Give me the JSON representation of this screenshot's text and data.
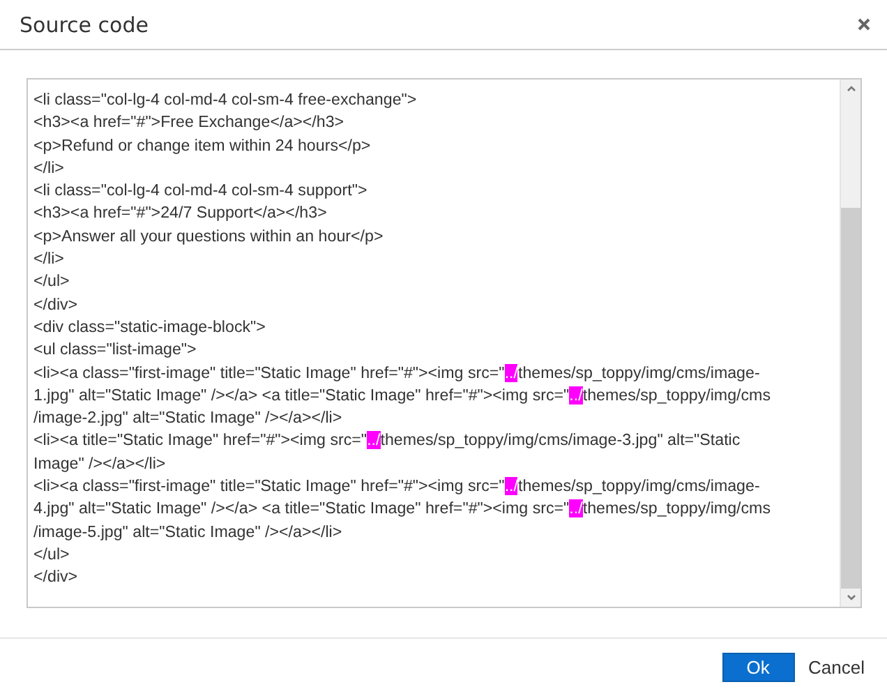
{
  "dialog": {
    "title": "Source code"
  },
  "code_lines": [
    [
      {
        "text": "<li class=\"col-lg-4 col-md-4 col-sm-4 free-exchange\">",
        "highlighted": false
      }
    ],
    [
      {
        "text": "<h3><a href=\"#\">Free Exchange</a></h3>",
        "highlighted": false
      }
    ],
    [
      {
        "text": "<p>Refund or change item within 24 hours</p>",
        "highlighted": false
      }
    ],
    [
      {
        "text": "</li>",
        "highlighted": false
      }
    ],
    [
      {
        "text": "<li class=\"col-lg-4 col-md-4 col-sm-4 support\">",
        "highlighted": false
      }
    ],
    [
      {
        "text": "<h3><a href=\"#\">24/7 Support</a></h3>",
        "highlighted": false
      }
    ],
    [
      {
        "text": "<p>Answer all your questions within an hour</p>",
        "highlighted": false
      }
    ],
    [
      {
        "text": "</li>",
        "highlighted": false
      }
    ],
    [
      {
        "text": "</ul>",
        "highlighted": false
      }
    ],
    [
      {
        "text": "</div>",
        "highlighted": false
      }
    ],
    [
      {
        "text": "<div class=\"static-image-block\">",
        "highlighted": false
      }
    ],
    [
      {
        "text": "<ul class=\"list-image\">",
        "highlighted": false
      }
    ],
    [
      {
        "text": "<li><a class=\"first-image\" title=\"Static Image\" href=\"#\"><img src=\"",
        "highlighted": false
      },
      {
        "text": "../",
        "highlighted": true
      },
      {
        "text": "themes/sp_toppy/img/cms/image-",
        "highlighted": false
      }
    ],
    [
      {
        "text": "1.jpg\" alt=\"Static Image\" /></a> <a title=\"Static Image\" href=\"#\"><img src=\"",
        "highlighted": false
      },
      {
        "text": "../",
        "highlighted": true
      },
      {
        "text": "themes/sp_toppy/img/cms",
        "highlighted": false
      }
    ],
    [
      {
        "text": "/image-2.jpg\" alt=\"Static Image\" /></a></li>",
        "highlighted": false
      }
    ],
    [
      {
        "text": "<li><a title=\"Static Image\" href=\"#\"><img src=\"",
        "highlighted": false
      },
      {
        "text": "../",
        "highlighted": true
      },
      {
        "text": "themes/sp_toppy/img/cms/image-3.jpg\" alt=\"Static",
        "highlighted": false
      }
    ],
    [
      {
        "text": "Image\" /></a></li>",
        "highlighted": false
      }
    ],
    [
      {
        "text": "<li><a class=\"first-image\" title=\"Static Image\" href=\"#\"><img src=\"",
        "highlighted": false
      },
      {
        "text": "../",
        "highlighted": true
      },
      {
        "text": "themes/sp_toppy/img/cms/image-",
        "highlighted": false
      }
    ],
    [
      {
        "text": "4.jpg\" alt=\"Static Image\" /></a> <a title=\"Static Image\" href=\"#\"><img src=\"",
        "highlighted": false
      },
      {
        "text": "../",
        "highlighted": true
      },
      {
        "text": "themes/sp_toppy/img/cms",
        "highlighted": false
      }
    ],
    [
      {
        "text": "/image-5.jpg\" alt=\"Static Image\" /></a></li>",
        "highlighted": false
      }
    ],
    [
      {
        "text": "</ul>",
        "highlighted": false
      }
    ],
    [
      {
        "text": "</div>",
        "highlighted": false
      }
    ]
  ],
  "buttons": [
    {
      "label": "Ok",
      "kind": "primary"
    },
    {
      "label": "Cancel",
      "kind": "plain"
    }
  ]
}
